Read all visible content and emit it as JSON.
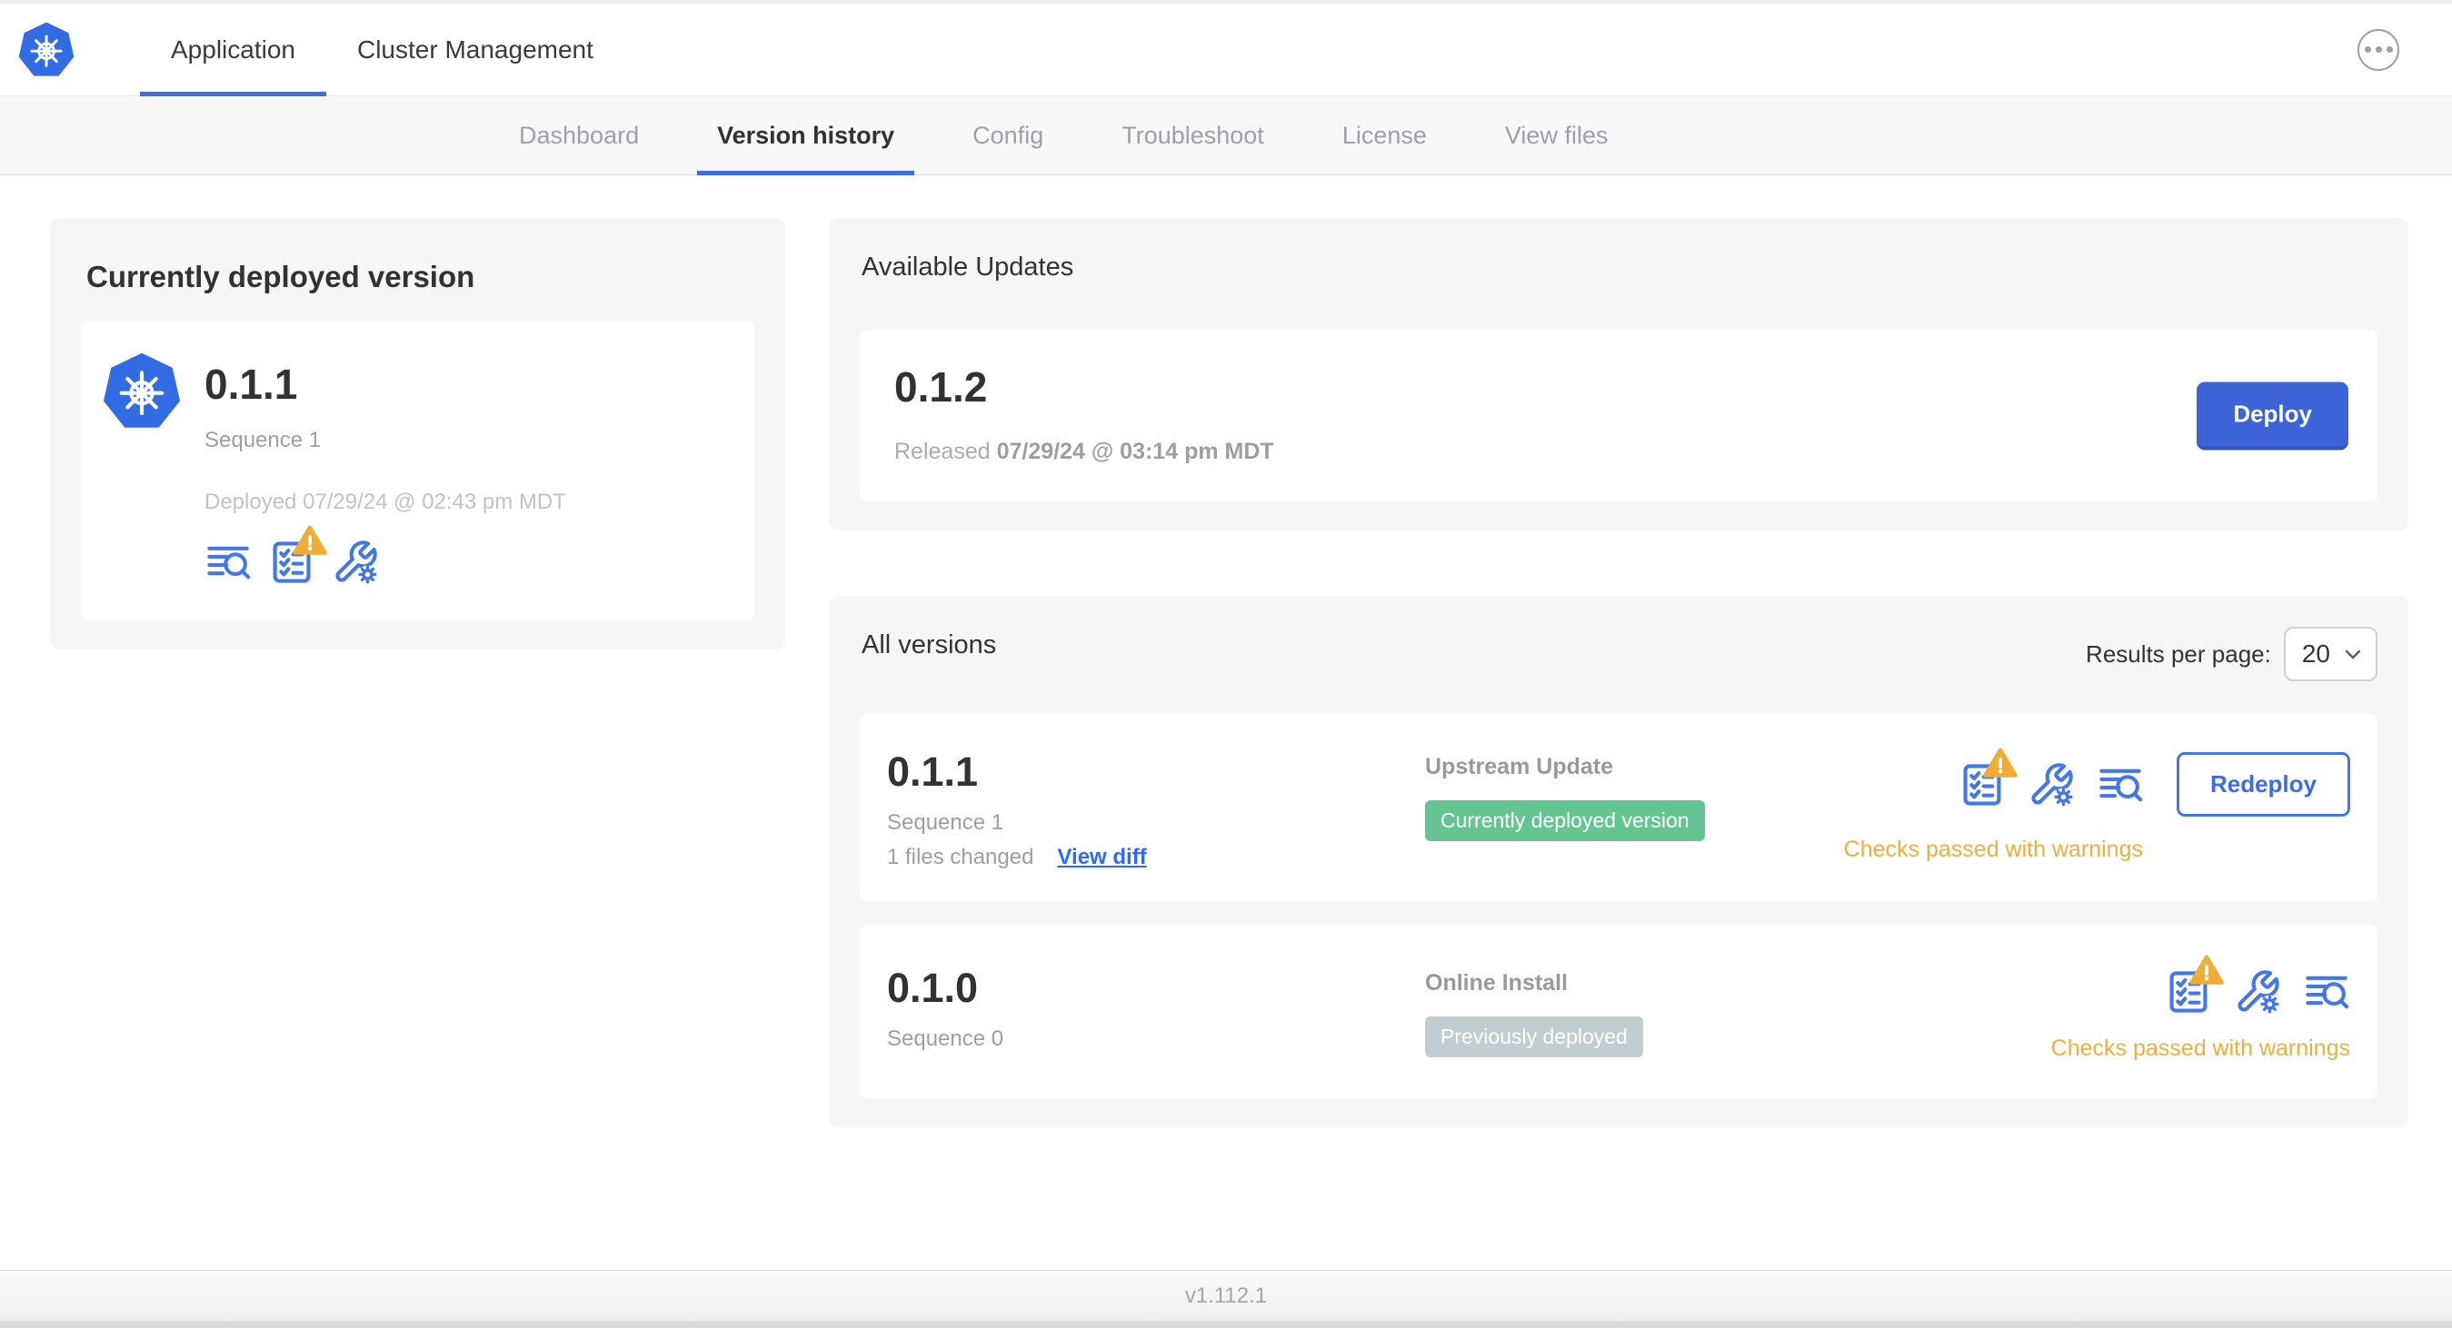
{
  "header": {
    "tabs": [
      {
        "label": "Application",
        "active": true
      },
      {
        "label": "Cluster Management",
        "active": false
      }
    ],
    "more_menu_icon": "circled-ellipsis-icon"
  },
  "subnav": {
    "tabs": [
      {
        "label": "Dashboard",
        "active": false
      },
      {
        "label": "Version history",
        "active": true
      },
      {
        "label": "Config",
        "active": false
      },
      {
        "label": "Troubleshoot",
        "active": false
      },
      {
        "label": "License",
        "active": false
      },
      {
        "label": "View files",
        "active": false
      }
    ]
  },
  "deployed_card": {
    "title": "Currently deployed version",
    "version": "0.1.1",
    "sequence": "Sequence 1",
    "deployed_at": "Deployed 07/29/24 @ 02:43 pm MDT",
    "icons": [
      "view-logs-icon",
      "preflight-checks-warning-icon",
      "edit-config-icon"
    ]
  },
  "available_updates": {
    "title": "Available Updates",
    "version": "0.1.2",
    "released_label": "Released",
    "released_at": "07/29/24 @ 03:14 pm MDT",
    "deploy_label": "Deploy"
  },
  "all_versions": {
    "title": "All versions",
    "results_per_page_label": "Results per page:",
    "results_per_page_value": "20",
    "rows": [
      {
        "version": "0.1.1",
        "sequence": "Sequence 1",
        "files_changed": "1 files changed",
        "view_diff_label": "View diff",
        "source": "Upstream Update",
        "badge": "Currently deployed version",
        "badge_type": "green",
        "status": "Checks passed with warnings",
        "action_label": "Redeploy",
        "icons": [
          "preflight-checks-warning-icon",
          "edit-config-icon",
          "view-logs-icon"
        ]
      },
      {
        "version": "0.1.0",
        "sequence": "Sequence 0",
        "source": "Online Install",
        "badge": "Previously deployed",
        "badge_type": "gray",
        "status": "Checks passed with warnings",
        "icons": [
          "preflight-checks-warning-icon",
          "edit-config-icon",
          "view-logs-icon"
        ]
      }
    ]
  },
  "footer": {
    "app_version": "v1.112.1"
  },
  "colors": {
    "brand_kubernetes_blue": "#326ce5",
    "primary_button_blue": "#3c64d6",
    "link_blue": "#2f6af0",
    "icon_blue": "#4377e8",
    "active_tab_underline": "#3e6ce0",
    "badge_green": "#65c592",
    "badge_gray": "#c2cdd1",
    "warning_yellow": "#efaf3f",
    "card_background": "#f4f6f8",
    "muted_text": "#9a9fa6"
  }
}
